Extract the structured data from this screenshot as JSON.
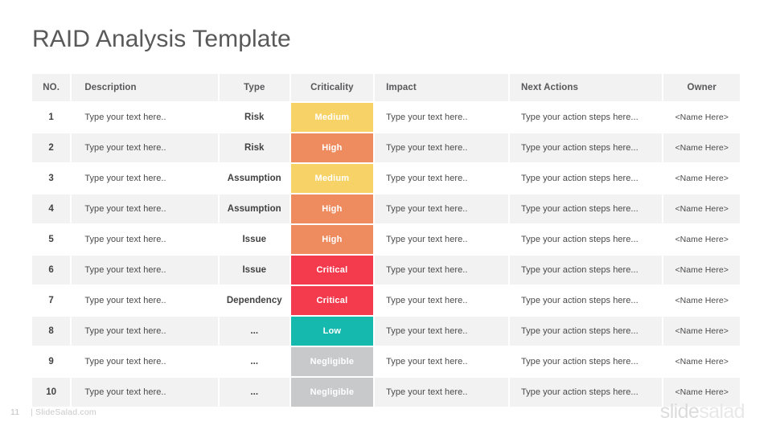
{
  "slide": {
    "title": "RAID Analysis Template",
    "page_number": "11",
    "site": "| SlideSalad.com",
    "brand_part1": "slide",
    "brand_part2": "salad"
  },
  "table": {
    "columns": [
      "NO.",
      "Description",
      "Type",
      "Criticality",
      "Impact",
      "Next Actions",
      "Owner"
    ],
    "rows": [
      {
        "no": "1",
        "description": "Type your text here..",
        "type": "Risk",
        "criticality": "Medium",
        "criticality_color": "#F7D367",
        "impact": "Type your text here..",
        "next_actions": "Type your action steps here...",
        "owner": "<Name Here>"
      },
      {
        "no": "2",
        "description": "Type your text here..",
        "type": "Risk",
        "criticality": "High",
        "criticality_color": "#EF8C5F",
        "impact": "Type your text here..",
        "next_actions": "Type your action steps here...",
        "owner": "<Name Here>"
      },
      {
        "no": "3",
        "description": "Type your text here..",
        "type": "Assumption",
        "criticality": "Medium",
        "criticality_color": "#F7D367",
        "impact": "Type your text here..",
        "next_actions": "Type your action steps here...",
        "owner": "<Name Here>"
      },
      {
        "no": "4",
        "description": "Type your text here..",
        "type": "Assumption",
        "criticality": "High",
        "criticality_color": "#EF8C5F",
        "impact": "Type your text here..",
        "next_actions": "Type your action steps here...",
        "owner": "<Name Here>"
      },
      {
        "no": "5",
        "description": "Type your text here..",
        "type": "Issue",
        "criticality": "High",
        "criticality_color": "#EF8C5F",
        "impact": "Type your text here..",
        "next_actions": "Type your action steps here...",
        "owner": "<Name Here>"
      },
      {
        "no": "6",
        "description": "Type your text here..",
        "type": "Issue",
        "criticality": "Critical",
        "criticality_color": "#F43B4E",
        "impact": "Type your text here..",
        "next_actions": "Type your action steps here...",
        "owner": "<Name Here>"
      },
      {
        "no": "7",
        "description": "Type your text here..",
        "type": "Dependency",
        "criticality": "Critical",
        "criticality_color": "#F43B4E",
        "impact": "Type your text here..",
        "next_actions": "Type your action steps here...",
        "owner": "<Name Here>"
      },
      {
        "no": "8",
        "description": "Type your text here..",
        "type": "...",
        "criticality": "Low",
        "criticality_color": "#15B9AE",
        "impact": "Type your text here..",
        "next_actions": "Type your action steps here...",
        "owner": "<Name Here>"
      },
      {
        "no": "9",
        "description": "Type your text here..",
        "type": "...",
        "criticality": "Negligible",
        "criticality_color": "#C8C9CB",
        "impact": "Type your text here..",
        "next_actions": "Type your action steps here...",
        "owner": "<Name Here>"
      },
      {
        "no": "10",
        "description": "Type your text here..",
        "type": "...",
        "criticality": "Negligible",
        "criticality_color": "#C8C9CB",
        "impact": "Type your text here..",
        "next_actions": "Type your action steps here...",
        "owner": "<Name Here>"
      }
    ]
  }
}
